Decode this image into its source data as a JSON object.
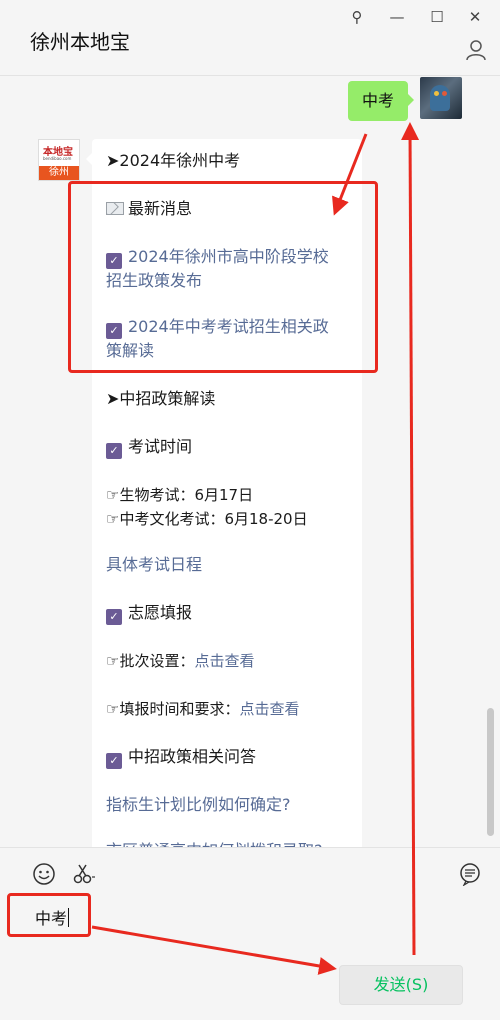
{
  "window": {
    "title": "徐州本地宝",
    "controls": {
      "pin": "⚲",
      "minimize": "—",
      "maximize": "☐",
      "close": "✕"
    }
  },
  "chat": {
    "my_message": "中考",
    "bot": {
      "avatar_brand": "本地宝",
      "avatar_url": "bendibao.com",
      "avatar_city": "徐州",
      "lines": {
        "l0": "➤2024年徐州中考",
        "l1": "最新消息",
        "l2a": "2024年徐州市高中阶段学校",
        "l2b": "招生政策发布",
        "l3a": "2024年中考考试招生相关政",
        "l3b": "策解读",
        "l4": "➤中招政策解读",
        "l5": "考试时间",
        "l6": "☞生物考试：6月17日",
        "l7": "☞中考文化考试：6月18-20日",
        "l8": "具体考试日程",
        "l9": "志愿填报",
        "l10a": "☞批次设置：",
        "l10b": "点击查看",
        "l11a": "☞填报时间和要求：",
        "l11b": "点击查看",
        "l12": "中招政策相关问答",
        "l13": "指标生计划比例如何确定?",
        "l14": "市区普通高中如何划拨和录取?"
      }
    }
  },
  "input": {
    "value": "中考",
    "send_label": "发送(S)"
  },
  "colors": {
    "my_bubble": "#95ec69",
    "link": "#576b95",
    "send_text": "#07c160",
    "annotation_red": "#e8291f"
  }
}
